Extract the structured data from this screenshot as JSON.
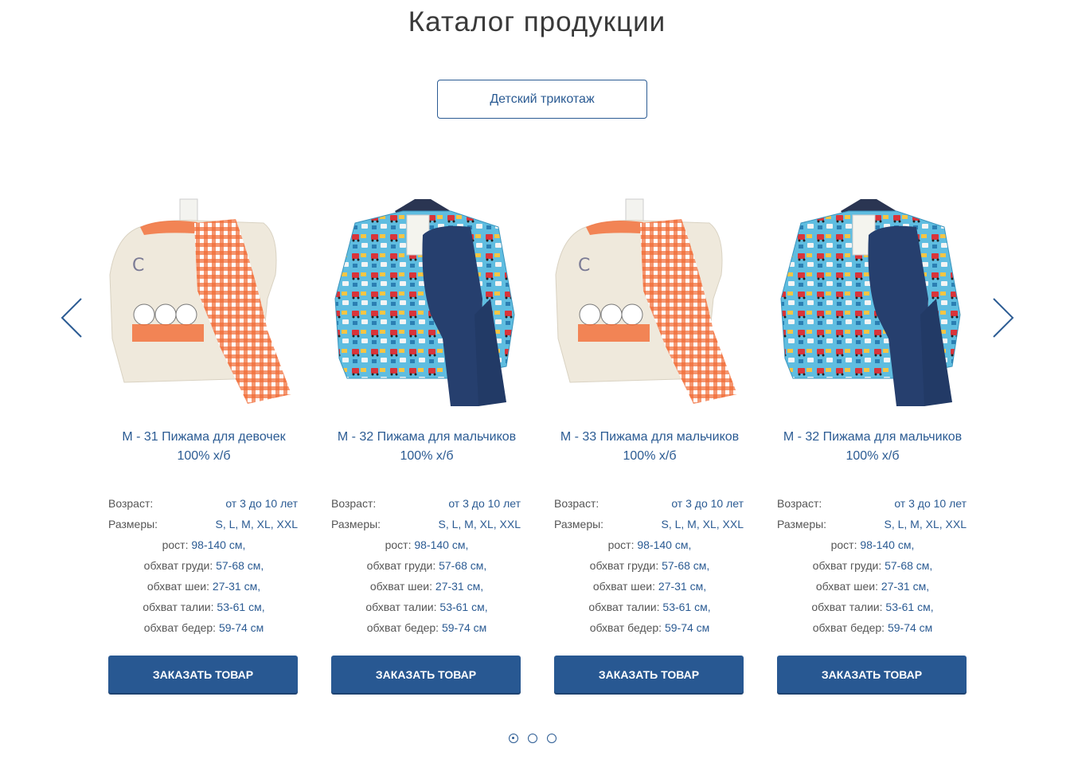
{
  "page": {
    "title": "Каталог продукции"
  },
  "category": {
    "label": "Детский трикотаж"
  },
  "labels": {
    "age": "Возраст:",
    "sizes": "Размеры:",
    "height": "рост:",
    "chest": "обхват груди:",
    "neck": "обхват шеи:",
    "waist": "обхват талии:",
    "hips": "обхват бедер:",
    "order_button": "ЗАКАЗАТЬ ТОВАР"
  },
  "products": [
    {
      "title_line1": "М - 31 Пижама для девочек",
      "title_line2": "100% х/б",
      "image": "pajama-girls-bunny-print-icon",
      "age": "от 3 до 10 лет",
      "sizes": "S, L, M, XL, XXL",
      "height": "98-140 см,",
      "chest": "57-68 см,",
      "neck": "27-31 см,",
      "waist": "53-61 см,",
      "hips": "59-74 см"
    },
    {
      "title_line1": "М - 32 Пижама для мальчиков",
      "title_line2": "100% х/б",
      "image": "pajama-boys-car-print-icon",
      "age": "от 3 до 10 лет",
      "sizes": "S, L, M, XL, XXL",
      "height": "98-140 см,",
      "chest": "57-68 см,",
      "neck": "27-31 см,",
      "waist": "53-61 см,",
      "hips": "59-74 см"
    },
    {
      "title_line1": "М - 33 Пижама для мальчиков",
      "title_line2": "100% х/б",
      "image": "pajama-girls-bunny-print-icon",
      "age": "от 3 до 10 лет",
      "sizes": "S, L, M, XL, XXL",
      "height": "98-140 см,",
      "chest": "57-68 см,",
      "neck": "27-31 см,",
      "waist": "53-61 см,",
      "hips": "59-74 см"
    },
    {
      "title_line1": "М - 32 Пижама для мальчиков",
      "title_line2": "100% х/б",
      "image": "pajama-boys-car-print-icon",
      "age": "от 3 до 10 лет",
      "sizes": "S, L, M, XL, XXL",
      "height": "98-140 см,",
      "chest": "57-68 см,",
      "neck": "27-31 см,",
      "waist": "53-61 см,",
      "hips": "59-74 см"
    }
  ],
  "carousel": {
    "page_count": 3,
    "active_page": 1
  },
  "colors": {
    "accent": "#2b5b93",
    "button": "#285892",
    "text": "#555555"
  }
}
